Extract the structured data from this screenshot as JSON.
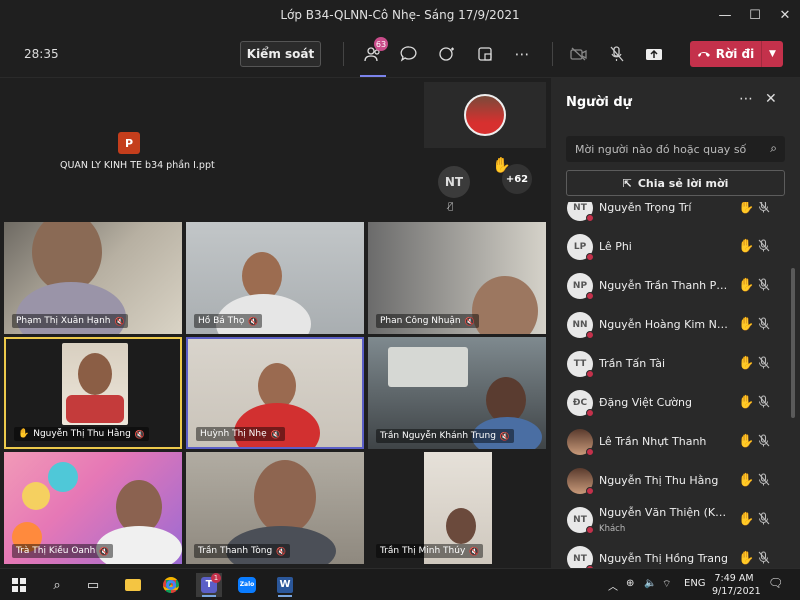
{
  "window": {
    "title": "Lớp B34-QLNN-Cô Nhẹ- Sáng 17/9/2021",
    "minimize": "—",
    "maximize": "☐",
    "close": "✕"
  },
  "toolbar": {
    "timer": "28:35",
    "control_label": "Kiểm soát",
    "people_badge": "63",
    "leave_label": "Rời đi"
  },
  "stage": {
    "shared_file": "QUAN LY KINH TE b34 phần I.ppt",
    "nt_initials": "NT",
    "overflow_count": "+62"
  },
  "tiles": [
    {
      "name": "Phạm Thị Xuân Hạnh",
      "hand": false
    },
    {
      "name": "Hồ Bá Thọ",
      "hand": false
    },
    {
      "name": "Phan Công Nhuận",
      "hand": false
    },
    {
      "name": "Nguyễn Thị Thu Hằng",
      "hand": true
    },
    {
      "name": "Huỳnh Thị Nhẹ",
      "hand": false
    },
    {
      "name": "Trần Nguyễn Khánh Trung",
      "hand": false
    },
    {
      "name": "Trà Thị Kiều Oanh",
      "hand": false
    },
    {
      "name": "Trần Thanh Tòng",
      "hand": false
    },
    {
      "name": "Trần Thị Minh Thúy",
      "hand": false
    }
  ],
  "panel": {
    "title": "Người dự",
    "search_placeholder": "Mời người nào đó hoặc quay số",
    "share_label": "Chia sẻ lời mời",
    "people": [
      {
        "initials": "NT",
        "name": "Nguyễn Trọng Trí",
        "photo": false,
        "sub": ""
      },
      {
        "initials": "LP",
        "name": "Lê Phi",
        "photo": false,
        "sub": ""
      },
      {
        "initials": "NP",
        "name": "Nguyễn Trần Thanh Phươ...",
        "photo": false,
        "sub": ""
      },
      {
        "initials": "NN",
        "name": "Nguyễn Hoàng Kim Ngân",
        "photo": false,
        "sub": ""
      },
      {
        "initials": "TT",
        "name": "Trần Tấn Tài",
        "photo": false,
        "sub": ""
      },
      {
        "initials": "ĐC",
        "name": "Đặng Việt Cường",
        "photo": false,
        "sub": ""
      },
      {
        "initials": "",
        "name": "Lê Trần Nhựt Thanh",
        "photo": true,
        "sub": ""
      },
      {
        "initials": "",
        "name": "Nguyễn Thị Thu Hằng",
        "photo": true,
        "sub": ""
      },
      {
        "initials": "NT",
        "name": "Nguyễn Văn Thiện (Khách)",
        "photo": false,
        "sub": "Khách"
      },
      {
        "initials": "NT",
        "name": "Nguyễn Thị Hồng Trang",
        "photo": false,
        "sub": ""
      }
    ]
  },
  "taskbar": {
    "lang": "ENG",
    "time": "7:49 AM",
    "date": "9/17/2021",
    "teams_badge": "1"
  }
}
